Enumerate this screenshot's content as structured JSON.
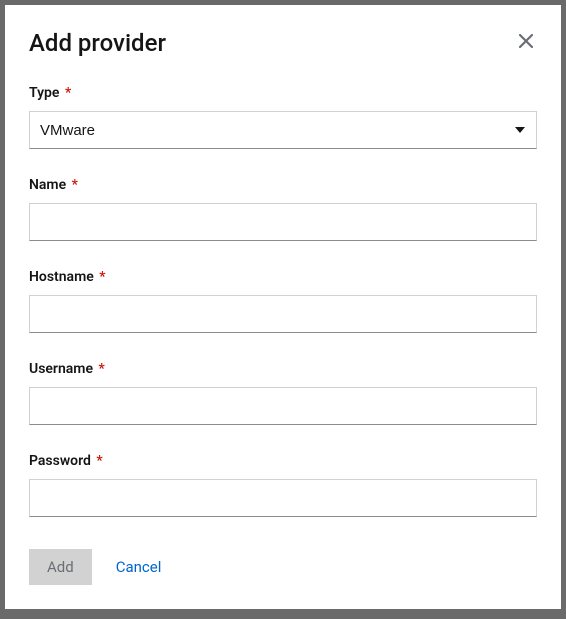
{
  "modal": {
    "title": "Add provider"
  },
  "fields": {
    "type": {
      "label": "Type",
      "value": "VMware"
    },
    "name": {
      "label": "Name",
      "value": ""
    },
    "hostname": {
      "label": "Hostname",
      "value": ""
    },
    "username": {
      "label": "Username",
      "value": ""
    },
    "password": {
      "label": "Password",
      "value": ""
    }
  },
  "required_marker": "*",
  "footer": {
    "add": "Add",
    "cancel": "Cancel"
  }
}
